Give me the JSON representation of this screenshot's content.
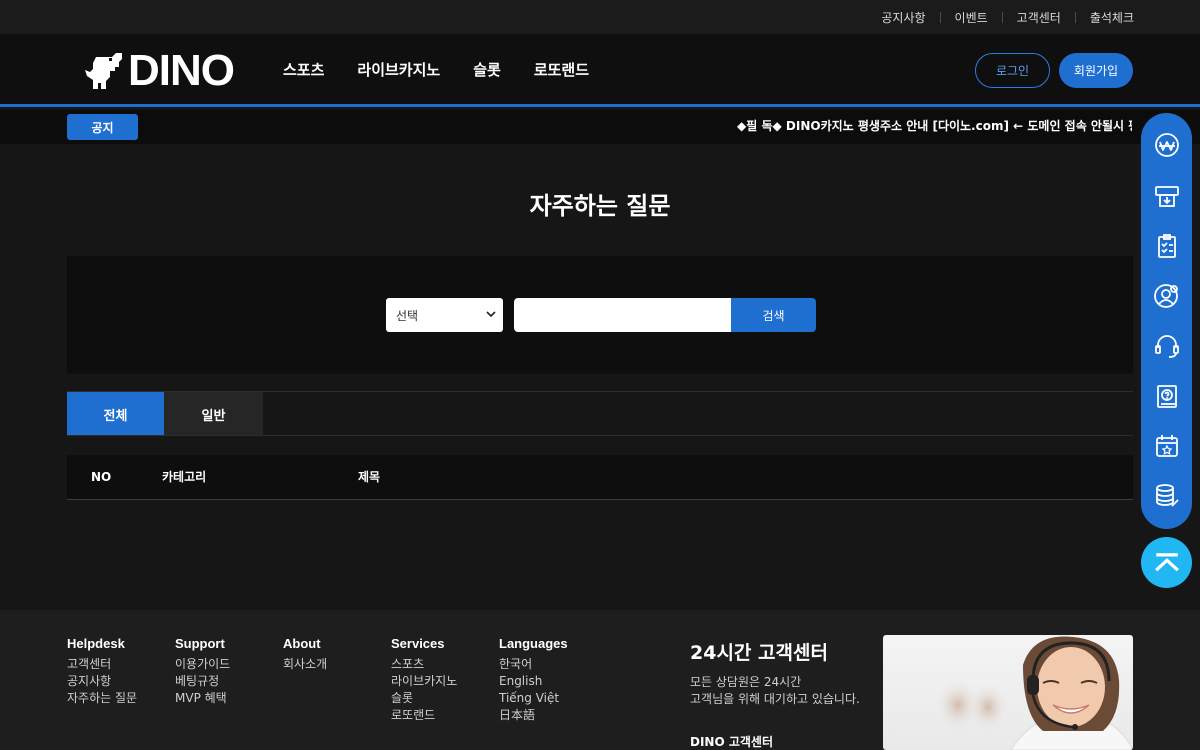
{
  "top_links": [
    "공지사항",
    "이벤트",
    "고객센터",
    "출석체크"
  ],
  "logo": {
    "word": "DINO"
  },
  "nav": [
    "스포츠",
    "라이브카지노",
    "슬롯",
    "로또랜드"
  ],
  "auth": {
    "login": "로그인",
    "join": "회원가입"
  },
  "notice": {
    "badge": "공지",
    "text": "◆필 독◆ DINO카지노 평생주소 안내 [다이노.com] ← 도메인 접속 안될시 평생주"
  },
  "page_title": "자주하는 질문",
  "search": {
    "select_value": "선택",
    "input_value": "",
    "button": "검색"
  },
  "tabs": [
    {
      "label": "전체",
      "active": true
    },
    {
      "label": "일반",
      "active": false
    }
  ],
  "table": {
    "columns": [
      "NO",
      "카테고리",
      "제목"
    ]
  },
  "quick_menu": [
    "currency-icon",
    "download-card-icon",
    "clipboard-check-icon",
    "user-settings-icon",
    "headset-icon",
    "help-book-icon",
    "calendar-star-icon",
    "coins-icon"
  ],
  "footer": {
    "columns": [
      {
        "heading": "Helpdesk",
        "links": [
          "고객센터",
          "공지사항",
          "자주하는 질문"
        ]
      },
      {
        "heading": "Support",
        "links": [
          "이용가이드",
          "베팅규정",
          "MVP 혜택"
        ]
      },
      {
        "heading": "About",
        "links": [
          "회사소개"
        ]
      },
      {
        "heading": "Services",
        "links": [
          "스포츠",
          "라이브카지노",
          "슬롯",
          "로또랜드"
        ]
      },
      {
        "heading": "Languages",
        "links": [
          "한국어",
          "English",
          "Tiếng Việt",
          "日本語"
        ]
      }
    ],
    "cs_title": "24시간  고객센터",
    "cs_line1": "모든 상담원은 24시간",
    "cs_line2": "고객님을 위해 대기하고 있습니다.",
    "cs_sub": "DINO 고객센터"
  },
  "colors": {
    "accent": "#1f6fd1",
    "top_button": "#21b7f2",
    "background": "#161616"
  }
}
